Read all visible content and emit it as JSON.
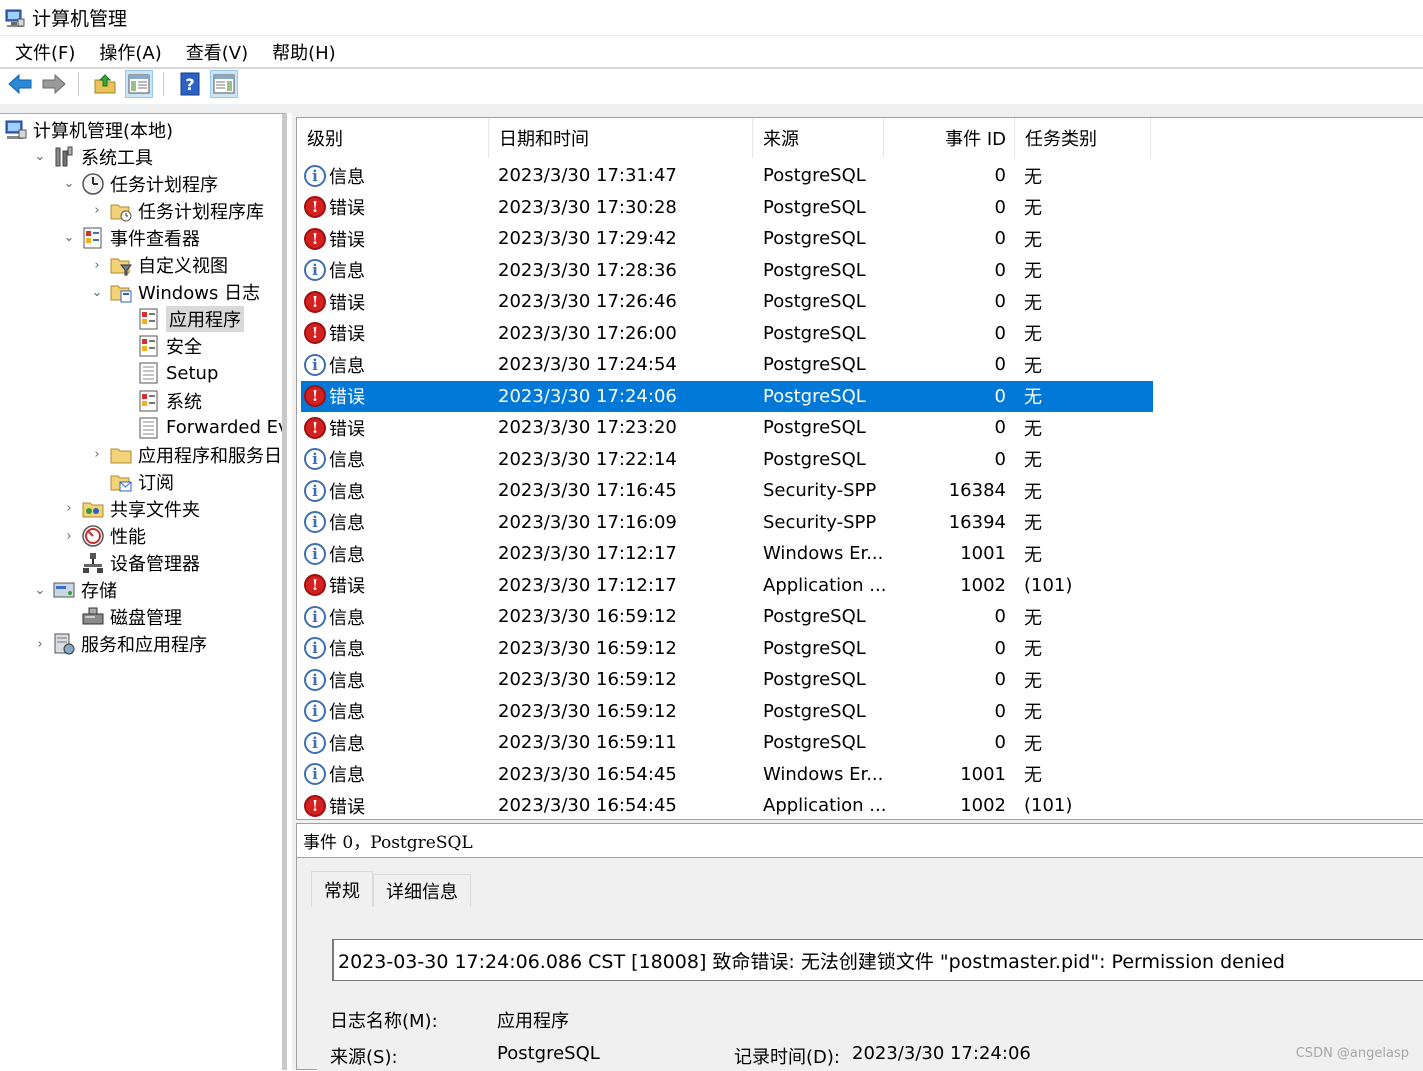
{
  "window": {
    "title": "计算机管理"
  },
  "menu": [
    "文件(F)",
    "操作(A)",
    "查看(V)",
    "帮助(H)"
  ],
  "toolbar": {
    "buttons": [
      "back-arrow-icon",
      "forward-arrow-icon",
      "up-folder-icon",
      "show-hide-tree-icon",
      "help-icon",
      "show-hide-action-pane-icon"
    ]
  },
  "tree": [
    {
      "label": "计算机管理(本地)",
      "level": 0,
      "expander": "",
      "icon": "computer-management-icon"
    },
    {
      "label": "系统工具",
      "level": 1,
      "expander": "v",
      "icon": "tools-icon"
    },
    {
      "label": "任务计划程序",
      "level": 2,
      "expander": "v",
      "icon": "clock-icon"
    },
    {
      "label": "任务计划程序库",
      "level": 3,
      "expander": ">",
      "icon": "folder-clock-icon"
    },
    {
      "label": "事件查看器",
      "level": 2,
      "expander": "v",
      "icon": "event-viewer-icon"
    },
    {
      "label": "自定义视图",
      "level": 3,
      "expander": ">",
      "icon": "folder-filter-icon"
    },
    {
      "label": "Windows 日志",
      "level": 3,
      "expander": "v",
      "icon": "folder-log-icon"
    },
    {
      "label": "应用程序",
      "level": 4,
      "expander": "",
      "icon": "log-icon",
      "selected": true
    },
    {
      "label": "安全",
      "level": 4,
      "expander": "",
      "icon": "log-icon"
    },
    {
      "label": "Setup",
      "level": 4,
      "expander": "",
      "icon": "log-plain-icon"
    },
    {
      "label": "系统",
      "level": 4,
      "expander": "",
      "icon": "log-icon"
    },
    {
      "label": "Forwarded Even",
      "level": 4,
      "expander": "",
      "icon": "log-plain-icon"
    },
    {
      "label": "应用程序和服务日志",
      "level": 3,
      "expander": ">",
      "icon": "folder-icon"
    },
    {
      "label": "订阅",
      "level": 3,
      "expander": "",
      "icon": "subscription-icon"
    },
    {
      "label": "共享文件夹",
      "level": 2,
      "expander": ">",
      "icon": "shared-folder-icon"
    },
    {
      "label": "性能",
      "level": 2,
      "expander": ">",
      "icon": "performance-icon"
    },
    {
      "label": "设备管理器",
      "level": 2,
      "expander": "",
      "icon": "device-manager-icon"
    },
    {
      "label": "存储",
      "level": 1,
      "expander": "v",
      "icon": "storage-icon"
    },
    {
      "label": "磁盘管理",
      "level": 2,
      "expander": "",
      "icon": "disk-icon"
    },
    {
      "label": "服务和应用程序",
      "level": 1,
      "expander": ">",
      "icon": "services-icon"
    }
  ],
  "columns": [
    "级别",
    "日期和时间",
    "来源",
    "事件 ID",
    "任务类别"
  ],
  "events": [
    {
      "level": "信息",
      "type": "info",
      "datetime": "2023/3/30 17:31:47",
      "source": "PostgreSQL",
      "id": "0",
      "category": "无"
    },
    {
      "level": "错误",
      "type": "error",
      "datetime": "2023/3/30 17:30:28",
      "source": "PostgreSQL",
      "id": "0",
      "category": "无"
    },
    {
      "level": "错误",
      "type": "error",
      "datetime": "2023/3/30 17:29:42",
      "source": "PostgreSQL",
      "id": "0",
      "category": "无"
    },
    {
      "level": "信息",
      "type": "info",
      "datetime": "2023/3/30 17:28:36",
      "source": "PostgreSQL",
      "id": "0",
      "category": "无"
    },
    {
      "level": "错误",
      "type": "error",
      "datetime": "2023/3/30 17:26:46",
      "source": "PostgreSQL",
      "id": "0",
      "category": "无"
    },
    {
      "level": "错误",
      "type": "error",
      "datetime": "2023/3/30 17:26:00",
      "source": "PostgreSQL",
      "id": "0",
      "category": "无"
    },
    {
      "level": "信息",
      "type": "info",
      "datetime": "2023/3/30 17:24:54",
      "source": "PostgreSQL",
      "id": "0",
      "category": "无"
    },
    {
      "level": "错误",
      "type": "error",
      "datetime": "2023/3/30 17:24:06",
      "source": "PostgreSQL",
      "id": "0",
      "category": "无",
      "selected": true
    },
    {
      "level": "错误",
      "type": "error",
      "datetime": "2023/3/30 17:23:20",
      "source": "PostgreSQL",
      "id": "0",
      "category": "无"
    },
    {
      "level": "信息",
      "type": "info",
      "datetime": "2023/3/30 17:22:14",
      "source": "PostgreSQL",
      "id": "0",
      "category": "无"
    },
    {
      "level": "信息",
      "type": "info",
      "datetime": "2023/3/30 17:16:45",
      "source": "Security-SPP",
      "id": "16384",
      "category": "无"
    },
    {
      "level": "信息",
      "type": "info",
      "datetime": "2023/3/30 17:16:09",
      "source": "Security-SPP",
      "id": "16394",
      "category": "无"
    },
    {
      "level": "信息",
      "type": "info",
      "datetime": "2023/3/30 17:12:17",
      "source": "Windows Er...",
      "id": "1001",
      "category": "无"
    },
    {
      "level": "错误",
      "type": "error",
      "datetime": "2023/3/30 17:12:17",
      "source": "Application ...",
      "id": "1002",
      "category": "(101)"
    },
    {
      "level": "信息",
      "type": "info",
      "datetime": "2023/3/30 16:59:12",
      "source": "PostgreSQL",
      "id": "0",
      "category": "无"
    },
    {
      "level": "信息",
      "type": "info",
      "datetime": "2023/3/30 16:59:12",
      "source": "PostgreSQL",
      "id": "0",
      "category": "无"
    },
    {
      "level": "信息",
      "type": "info",
      "datetime": "2023/3/30 16:59:12",
      "source": "PostgreSQL",
      "id": "0",
      "category": "无"
    },
    {
      "level": "信息",
      "type": "info",
      "datetime": "2023/3/30 16:59:12",
      "source": "PostgreSQL",
      "id": "0",
      "category": "无"
    },
    {
      "level": "信息",
      "type": "info",
      "datetime": "2023/3/30 16:59:11",
      "source": "PostgreSQL",
      "id": "0",
      "category": "无"
    },
    {
      "level": "信息",
      "type": "info",
      "datetime": "2023/3/30 16:54:45",
      "source": "Windows Er...",
      "id": "1001",
      "category": "无"
    },
    {
      "level": "错误",
      "type": "error",
      "datetime": "2023/3/30 16:54:45",
      "source": "Application ...",
      "id": "1002",
      "category": "(101)"
    }
  ],
  "detail": {
    "header": "事件 0，PostgreSQL",
    "tabs": [
      "常规",
      "详细信息"
    ],
    "message": "2023-03-30 17:24:06.086 CST [18008] 致命错误:  无法创建锁文件 \"postmaster.pid\": Permission denied",
    "log_name_label": "日志名称(M):",
    "log_name_value": "应用程序",
    "source_label": "来源(S):",
    "source_value": "PostgreSQL",
    "logged_label": "记录时间(D):",
    "logged_value": "2023/3/30 17:24:06"
  },
  "watermark": "CSDN @angelasp",
  "colors": {
    "selection": "#0078d7",
    "error": "#d32020",
    "info": "#3e6fb4"
  }
}
